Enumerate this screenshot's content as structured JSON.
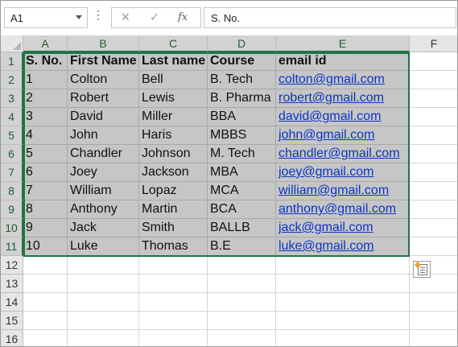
{
  "formula_bar": {
    "name_box": "A1",
    "cancel_icon": "✕",
    "enter_icon": "✓",
    "fx_label": "fx",
    "formula": "S. No."
  },
  "columns": [
    "A",
    "B",
    "C",
    "D",
    "E",
    "F"
  ],
  "rows": [
    "1",
    "2",
    "3",
    "4",
    "5",
    "6",
    "7",
    "8",
    "9",
    "10",
    "11",
    "12",
    "13",
    "14",
    "15",
    "16"
  ],
  "table": {
    "headers": [
      "S. No.",
      "First Name",
      "Last name",
      "Course",
      "email id"
    ],
    "rows": [
      [
        "1",
        "Colton",
        "Bell",
        "B. Tech",
        "colton@gmail.com"
      ],
      [
        "2",
        "Robert",
        "Lewis",
        "B. Pharma",
        "robert@gmail.com"
      ],
      [
        "3",
        "David",
        "Miller",
        "BBA",
        "david@gmail.com"
      ],
      [
        "4",
        "John",
        "Haris",
        "MBBS",
        "john@gmail.com"
      ],
      [
        "5",
        "Chandler",
        "Johnson",
        "M. Tech",
        "chandler@gmail.com"
      ],
      [
        "6",
        "Joey",
        "Jackson",
        "MBA",
        "joey@gmail.com"
      ],
      [
        "7",
        "William",
        "Lopaz",
        "MCA",
        "william@gmail.com"
      ],
      [
        "8",
        "Anthony",
        "Martin",
        "BCA",
        "anthony@gmail.com"
      ],
      [
        "9",
        "Jack",
        "Smith",
        "BALLB",
        "jack@gmail.com"
      ],
      [
        "10",
        "Luke",
        "Thomas",
        "B.E",
        "luke@gmail.com"
      ]
    ]
  },
  "colors": {
    "selection_border": "#217346",
    "selection_fill": "#c6c6c6",
    "link": "#0b35c5"
  },
  "icons": [
    "dropdown-arrow-icon",
    "cancel-icon",
    "enter-icon",
    "fx-icon",
    "quick-analysis-icon"
  ]
}
